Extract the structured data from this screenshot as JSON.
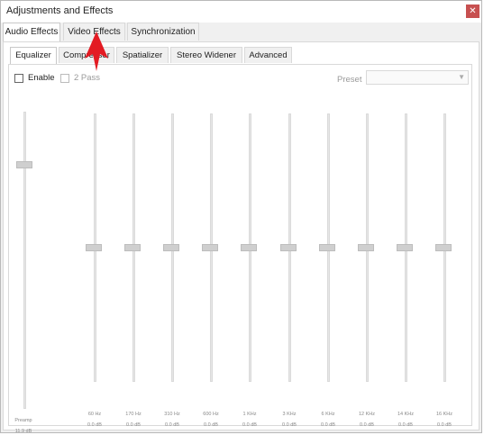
{
  "window": {
    "title": "Adjustments and Effects",
    "close_icon": "close-icon"
  },
  "top_tabs": [
    {
      "label": "Audio Effects",
      "active": true
    },
    {
      "label": "Video Effects",
      "active": false
    },
    {
      "label": "Synchronization",
      "active": false
    }
  ],
  "audio_tabs": [
    {
      "label": "Equalizer",
      "active": true
    },
    {
      "label": "Compressor",
      "active": false
    },
    {
      "label": "Spatializer",
      "active": false
    },
    {
      "label": "Stereo Widener",
      "active": false
    },
    {
      "label": "Advanced",
      "active": false
    }
  ],
  "equalizer": {
    "enable_label": "Enable",
    "enable_checked": false,
    "two_pass_label": "2 Pass",
    "two_pass_checked": false,
    "preset_label": "Preset",
    "preset_value": "",
    "preamp": {
      "label": "Preamp",
      "value": "11.9 dB",
      "level": 0.82
    },
    "bands": [
      {
        "freq": "60 Hz",
        "value": "0.0 dB",
        "level": 0.5
      },
      {
        "freq": "170 Hz",
        "value": "0.0 dB",
        "level": 0.5
      },
      {
        "freq": "310 Hz",
        "value": "0.0 dB",
        "level": 0.5
      },
      {
        "freq": "600 Hz",
        "value": "0.0 dB",
        "level": 0.5
      },
      {
        "freq": "1 KHz",
        "value": "0.0 dB",
        "level": 0.5
      },
      {
        "freq": "3 KHz",
        "value": "0.0 dB",
        "level": 0.5
      },
      {
        "freq": "6 KHz",
        "value": "0.0 dB",
        "level": 0.5
      },
      {
        "freq": "12 KHz",
        "value": "0.0 dB",
        "level": 0.5
      },
      {
        "freq": "14 KHz",
        "value": "0.0 dB",
        "level": 0.5
      },
      {
        "freq": "16 KHz",
        "value": "0.0 dB",
        "level": 0.5
      }
    ]
  },
  "colors": {
    "pointer_arrow": "#e31b23",
    "close_button": "#c75050"
  }
}
